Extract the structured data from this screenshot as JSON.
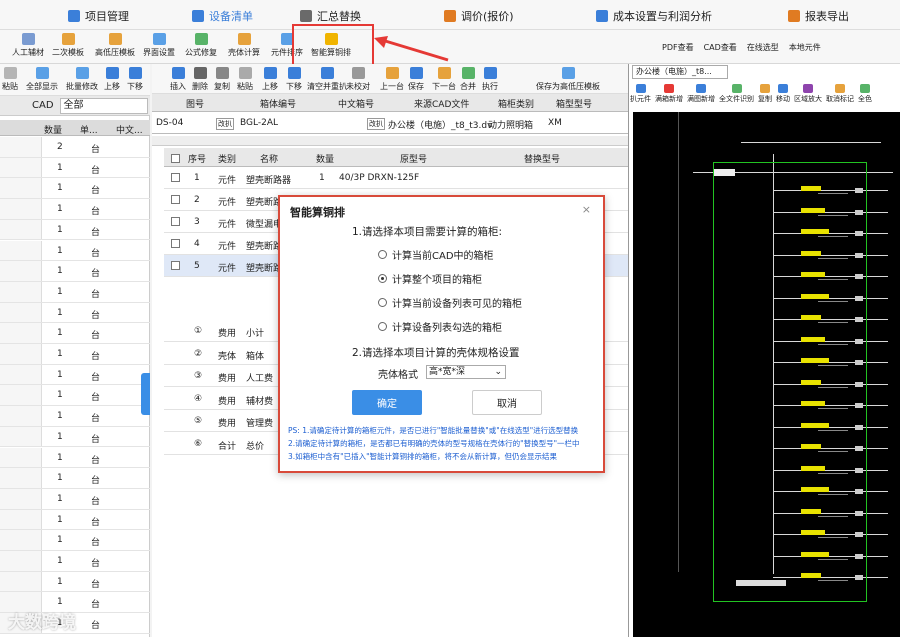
{
  "menu_tabs": [
    {
      "label": "项目管理",
      "color": "#3b7fd9"
    },
    {
      "label": "设备清单",
      "color": "#3b7fd9",
      "active": true
    },
    {
      "label": "汇总替换",
      "color": "#555"
    },
    {
      "label": "调价(报价)",
      "color": "#e07b22"
    },
    {
      "label": "成本设置与利润分析",
      "color": "#3b7fd9"
    },
    {
      "label": "报表导出",
      "color": "#e07b22"
    }
  ],
  "toolbar1": [
    "人工辅材",
    "二次模板",
    "高低压模板",
    "界面设置",
    "公式修复",
    "壳体计算",
    "元件排序",
    "智能算铜排"
  ],
  "toolbar1_right": [
    "PDF查看",
    "CAD查看",
    "在线选型",
    "本地元件"
  ],
  "toolbar2": [
    "粘贴",
    "全部显示",
    "批量修改",
    "上移",
    "下移"
  ],
  "cad_label": "CAD",
  "cad_value": "全部",
  "left_headers": [
    "数量",
    "单...",
    "中文..."
  ],
  "left_rows": [
    {
      "qty": "2",
      "unit": "台"
    },
    {
      "qty": "1",
      "unit": "台"
    },
    {
      "qty": "1",
      "unit": "台"
    },
    {
      "qty": "1",
      "unit": "台"
    },
    {
      "qty": "1",
      "unit": "台"
    },
    {
      "qty": "1",
      "unit": "台"
    },
    {
      "qty": "1",
      "unit": "台"
    },
    {
      "qty": "1",
      "unit": "台"
    },
    {
      "qty": "1",
      "unit": "台"
    },
    {
      "qty": "1",
      "unit": "台"
    },
    {
      "qty": "1",
      "unit": "台"
    },
    {
      "qty": "1",
      "unit": "台"
    },
    {
      "qty": "1",
      "unit": "台"
    },
    {
      "qty": "1",
      "unit": "台"
    },
    {
      "qty": "1",
      "unit": "台"
    },
    {
      "qty": "1",
      "unit": "台"
    },
    {
      "qty": "1",
      "unit": "台"
    },
    {
      "qty": "1",
      "unit": "台"
    },
    {
      "qty": "1",
      "unit": "台"
    },
    {
      "qty": "1",
      "unit": "台"
    },
    {
      "qty": "1",
      "unit": "台"
    },
    {
      "qty": "1",
      "unit": "台"
    },
    {
      "qty": "1",
      "unit": "台"
    },
    {
      "qty": "1",
      "unit": "台"
    }
  ],
  "mid_toolbar": [
    "插入",
    "删除",
    "复制",
    "粘贴",
    "上移",
    "下移",
    "清空并重扒",
    "未校对",
    "上一台",
    "保存",
    "下一台",
    "合并",
    "执行",
    "保存为高低压模板"
  ],
  "info_headers": [
    "图号",
    "箱体编号",
    "中文箱号",
    "来源CAD文件",
    "箱柜类别",
    "箱型型号"
  ],
  "info": {
    "drawing": "DS-04",
    "box_no": "BGL-2AL",
    "btn1": "改扒",
    "btn2": "改扒",
    "btn3": "改扒",
    "cad_file": "办公楼（电施）_t8_t3.dv",
    "category": "动力照明箱",
    "model": "XM"
  },
  "grid_headers": [
    "序号",
    "类别",
    "名称",
    "数量",
    "原型号",
    "替换型号"
  ],
  "grid_rows": [
    {
      "no": "1",
      "type": "元件",
      "name": "塑壳断路器",
      "qty": "1",
      "model": "40/3P DRXN-125F"
    },
    {
      "no": "2",
      "type": "元件",
      "name": "塑壳断路器",
      "qty": "",
      "model": ""
    },
    {
      "no": "3",
      "type": "元件",
      "name": "微型漏电",
      "qty": "",
      "model": ""
    },
    {
      "no": "4",
      "type": "元件",
      "name": "塑壳断路器",
      "qty": "",
      "model": ""
    },
    {
      "no": "5",
      "type": "元件",
      "name": "塑壳断路器",
      "qty": "",
      "model": ""
    }
  ],
  "fee_rows": [
    {
      "no": "①",
      "type": "费用",
      "name": "小计"
    },
    {
      "no": "②",
      "type": "壳体",
      "name": "箱体"
    },
    {
      "no": "③",
      "type": "费用",
      "name": "人工费"
    },
    {
      "no": "④",
      "type": "费用",
      "name": "辅材费"
    },
    {
      "no": "⑤",
      "type": "费用",
      "name": "管理费"
    },
    {
      "no": "⑥",
      "type": "合计",
      "name": "总价"
    }
  ],
  "right_tab": "办公楼（电施）_t8...",
  "right_toolbar": [
    "扒元件",
    "满箱新增",
    "满图新增",
    "全文件识别",
    "复制",
    "移动",
    "区域放大",
    "取消标记",
    "全色"
  ],
  "dialog": {
    "title": "智能算铜排",
    "q1": "1.请选择本项目需要计算的箱柜:",
    "options": [
      "计算当前CAD中的箱柜",
      "计算整个项目的箱柜",
      "计算当前设备列表可见的箱柜",
      "计算设备列表勾选的箱柜"
    ],
    "selected": 1,
    "q2": "2.请选择本项目计算的壳体规格设置",
    "shell_label": "壳体格式",
    "shell_value": "高*宽*深",
    "ok": "确定",
    "cancel": "取消",
    "ps": [
      "PS: 1.请确定待计算的箱柜元件，是否已进行\"智能批量替换\"或\"在线选型\"进行选型替换",
      "2.请确定待计算的箱柜，是否都已有明确的壳体的型号规格在壳体行的\"替换型号\"一栏中",
      "3.如箱柜中含有\"已插入\"智能计算铜排的箱柜，将不会从新计算，但仍会显示结果"
    ]
  },
  "watermark": "大数跨境"
}
